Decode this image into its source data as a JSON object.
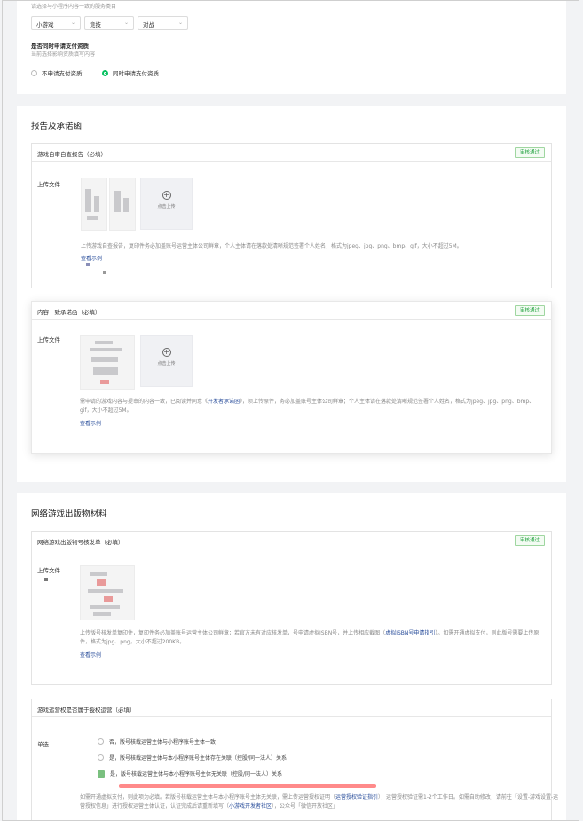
{
  "top": {
    "category_hint": "请选择与小程序内容一致的服务类目",
    "categories": [
      "小游戏",
      "竞技",
      "对战"
    ],
    "payment_label": "是否同时申请支付资质",
    "payment_hint": "当前选择影响资质填写内容",
    "payment_options": [
      "不申请支付资质",
      "同时申请支付资质"
    ],
    "payment_selected": 1
  },
  "report": {
    "title": "报告及承诺函",
    "self_check": {
      "title": "游戏自审自查报告（必填）",
      "badge": "审核通过",
      "upload_label": "上传文件",
      "upload_text": "点击上传",
      "desc": "上传游戏自查报告，复印件务必加盖账号运营主体公司鲜章，个人主体请在落款处清晰规范签署个人姓名，格式为jpeg、jpg、png、bmp、gif，大小不超过5M。",
      "example": "查看示例"
    },
    "consistency": {
      "title": "内容一致承诺函（必填）",
      "badge": "审核通过",
      "upload_label": "上传文件",
      "upload_text": "点击上传",
      "desc_pre": "需申请的游戏内容与提审的内容一致，已阅读并同意《",
      "desc_link": "开发者承诺函",
      "desc_post": "》，须上传原件，务必加盖账号主体公司鲜章；个人主体请在落款处清晰规范签署个人姓名，格式为jpeg、jpg、png、bmp、gif，大小不超过5M。",
      "example": "查看示例"
    }
  },
  "publish": {
    "title": "网络游戏出版物材料",
    "isbn": {
      "title": "网络游戏出版物号核发单（必填）",
      "badge": "审核通过",
      "upload_label": "上传文件",
      "desc_pre": "上传版号核发单复印件，复印件务必加盖账号运营主体公司鲜章；若官方未有对应核发单，号申请虚拟ISBN号，并上传相应截图（",
      "desc_link": "虚拟ISBN号申请指引",
      "desc_post": "）。如需开通虚拟支付，则此版号需要上传原件，格式为jpg、png，大小不超过200KB。",
      "example": "查看示例"
    },
    "license": {
      "title": "游戏运营权是否属于授权运营（必填）",
      "row_label": "单选",
      "options": [
        "否，版号核载运营主体与小程序账号主体一致",
        "是，版号核载运营主体与本小程序账号主体存在关联（控股/同一法人）关系",
        "是，版号核载运营主体与本小程序账号主体无关联（控股/同一法人）关系"
      ],
      "selected": 2,
      "desc_pre": "如需开通虚拟支付，则此项为必填。若版号核载运营主体与本小程序账号主体无关联，需上传运营授权证明（",
      "desc_link": "运营授权验证指引",
      "desc_mid": "），运营授权验证需1-2个工作日。如需自助修改，请前往「设置-游戏设置-运营授权信息」进行授权运营主体认证，认证完成后请重新填写（",
      "desc_link2": "小游戏开发者社区",
      "desc_post": "），公众号「微信开放社区」"
    }
  },
  "colors": {
    "accent_green": "#07c160",
    "badge_green": "#23a340",
    "link_blue": "#2a4e9b",
    "redacted_red": "#ff8a8a"
  }
}
